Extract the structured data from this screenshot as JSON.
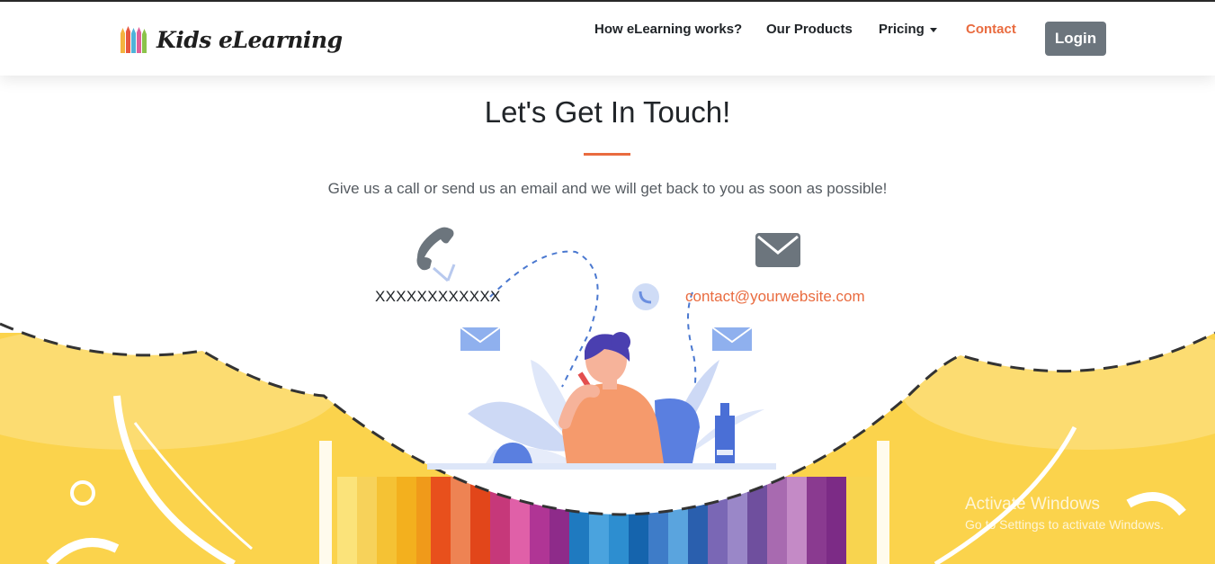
{
  "brand": {
    "name": "Kids eLearning"
  },
  "nav": {
    "items": [
      {
        "label": "How eLearning works?"
      },
      {
        "label": "Our Products"
      },
      {
        "label": "Pricing"
      },
      {
        "label": "Contact"
      }
    ],
    "login_label": "Login"
  },
  "contact": {
    "title": "Let's Get In Touch!",
    "subtitle": "Give us a call or send us an email and we will get back to you as soon as possible!",
    "phone": "XXXXXXXXXXXX",
    "email": "contact@yourwebsite.com"
  },
  "windows_watermark": {
    "line1": "Activate Windows",
    "line2": "Go to Settings to activate Windows."
  },
  "icons": {
    "phone": "phone-icon",
    "mail": "mail-icon",
    "logo": "pencils-icon"
  },
  "colors": {
    "accent": "#e96b3f",
    "button": "#6c757d",
    "yellow": "#fbd34c",
    "icon_gray": "#6c757d"
  }
}
